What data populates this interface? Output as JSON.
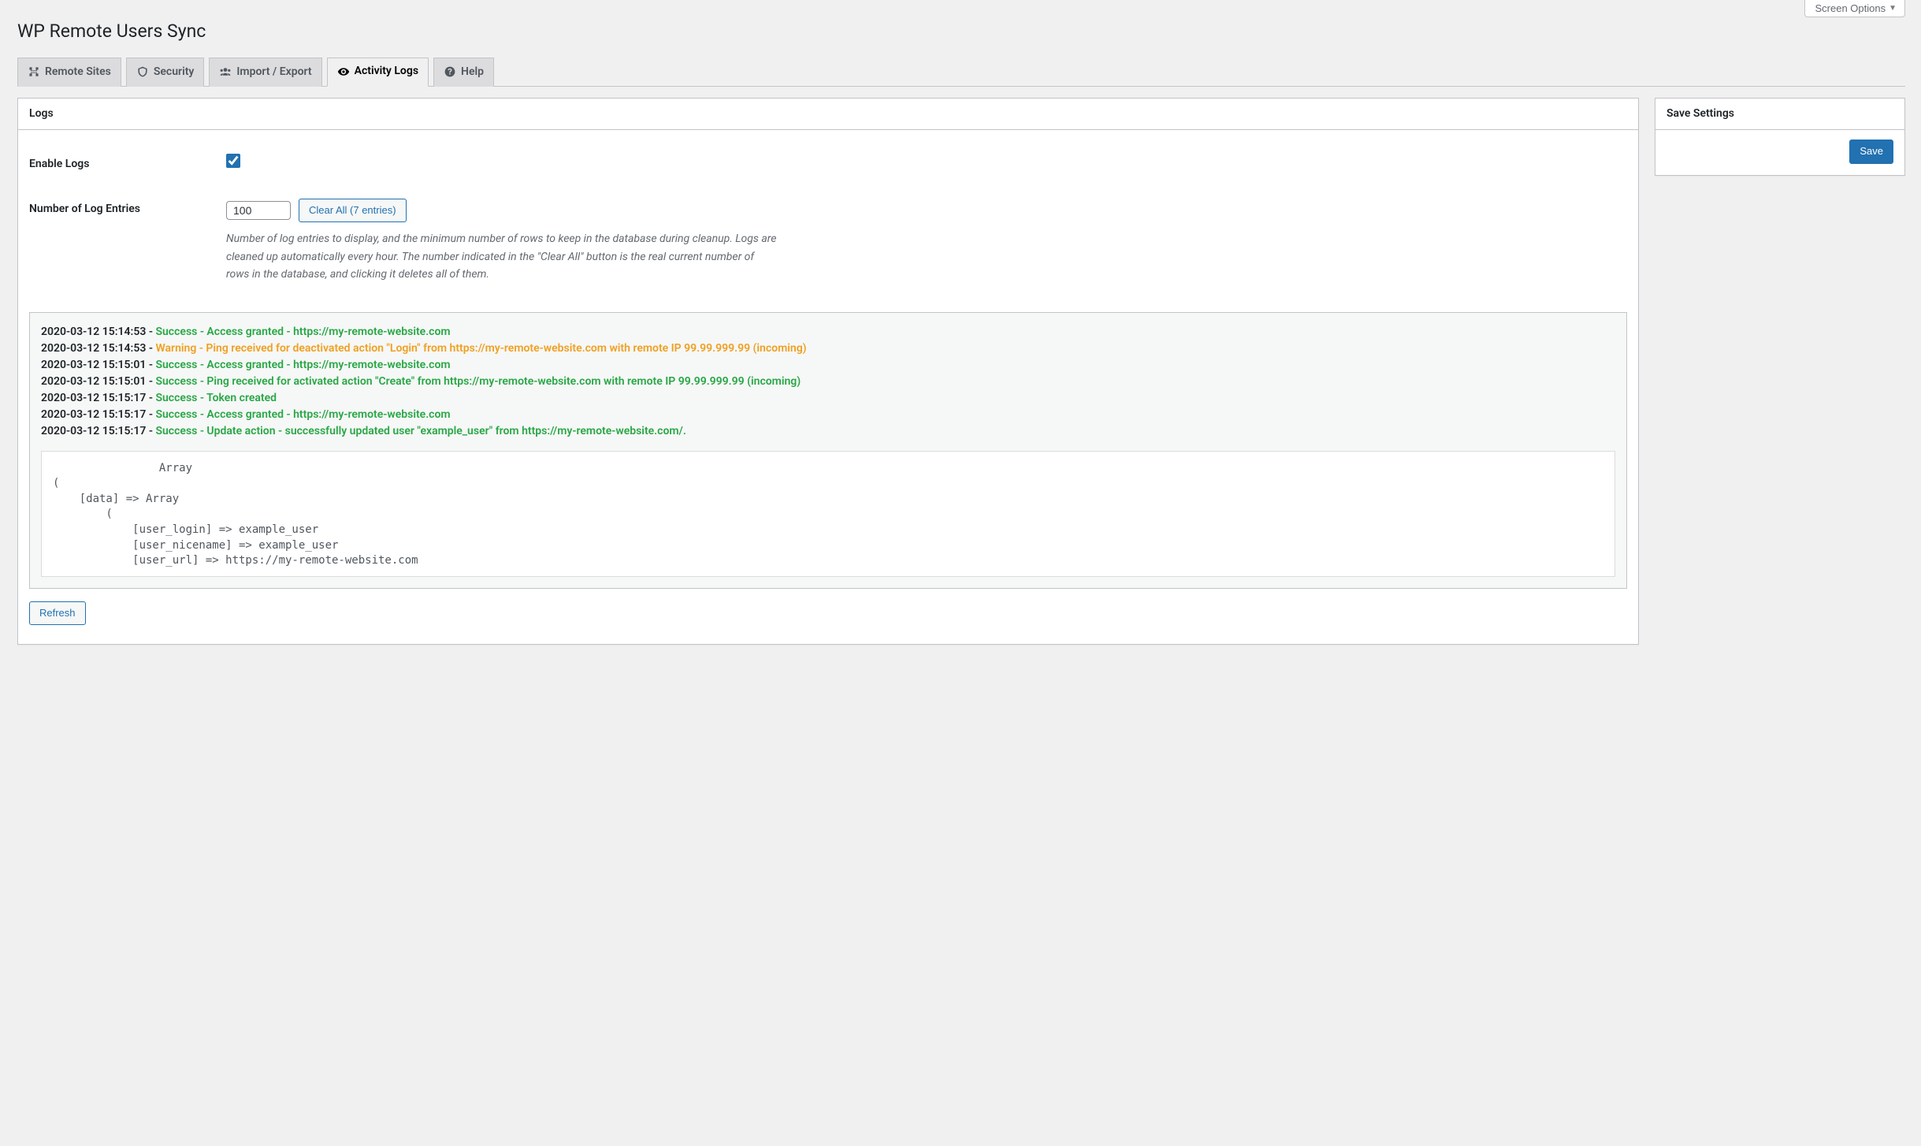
{
  "screen_options_label": "Screen Options",
  "page_title": "WP Remote Users Sync",
  "tabs": [
    {
      "label": "Remote Sites"
    },
    {
      "label": "Security"
    },
    {
      "label": "Import / Export"
    },
    {
      "label": "Activity Logs"
    },
    {
      "label": "Help"
    }
  ],
  "logs_heading": "Logs",
  "enable_logs_label": "Enable Logs",
  "num_entries_label": "Number of Log Entries",
  "num_entries_value": "100",
  "clear_all_label": "Clear All (7 entries)",
  "num_entries_description": "Number of log entries to display, and the minimum number of rows to keep in the database during cleanup. Logs are cleaned up automatically every hour. The number indicated in the \"Clear All\" button is the real current number of rows in the database, and clicking it deletes all of them.",
  "log_entries": [
    {
      "ts": "2020-03-12 15:14:53",
      "level": "success",
      "msg": "Success - Access granted - https://my-remote-website.com"
    },
    {
      "ts": "2020-03-12 15:14:53",
      "level": "warning",
      "msg": "Warning - Ping received for deactivated action \"Login\" from https://my-remote-website.com with remote IP 99.99.999.99 (incoming)"
    },
    {
      "ts": "2020-03-12 15:15:01",
      "level": "success",
      "msg": "Success - Access granted - https://my-remote-website.com"
    },
    {
      "ts": "2020-03-12 15:15:01",
      "level": "success",
      "msg": "Success - Ping received for activated action \"Create\" from https://my-remote-website.com with remote IP 99.99.999.99 (incoming)"
    },
    {
      "ts": "2020-03-12 15:15:17",
      "level": "success",
      "msg": "Success - Token created"
    },
    {
      "ts": "2020-03-12 15:15:17",
      "level": "success",
      "msg": "Success - Access granted - https://my-remote-website.com"
    },
    {
      "ts": "2020-03-12 15:15:17",
      "level": "success",
      "msg": "Success - Update action - successfully updated user \"example_user\" from https://my-remote-website.com/."
    }
  ],
  "log_dump": "                Array\n(\n    [data] => Array\n        (\n            [user_login] => example_user\n            [user_nicename] => example_user\n            [user_url] => https://my-remote-website.com",
  "refresh_label": "Refresh",
  "save_settings_heading": "Save Settings",
  "save_button_label": "Save"
}
